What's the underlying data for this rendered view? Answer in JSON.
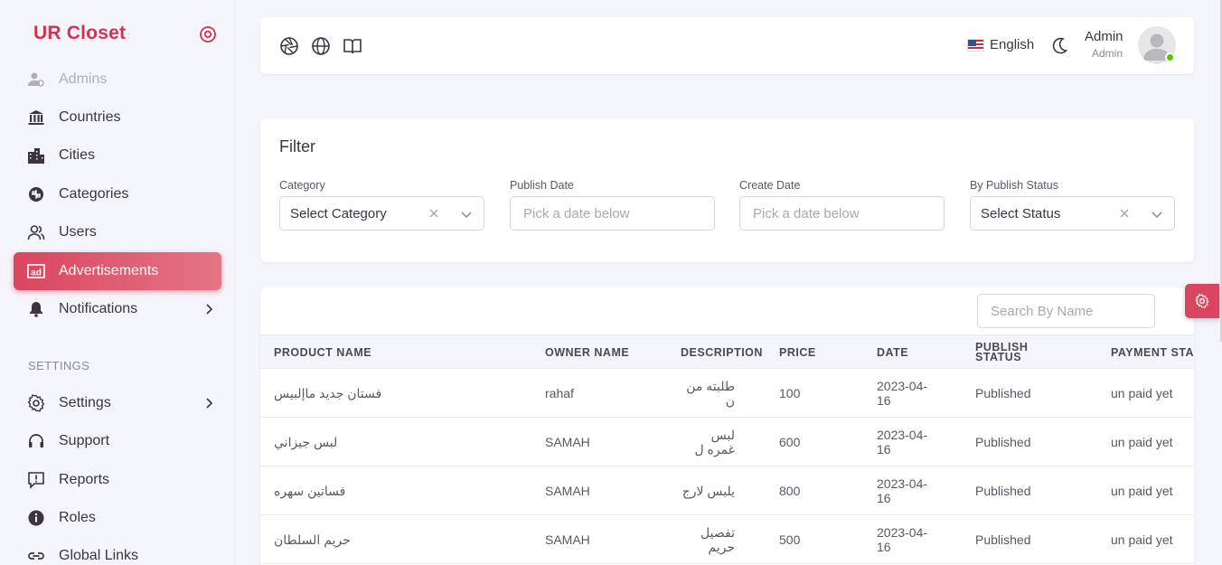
{
  "brand": {
    "name": "UR Closet",
    "color": "#d4324f"
  },
  "sidebar": {
    "items": [
      {
        "label": "Admins",
        "icon": "admin-icon"
      },
      {
        "label": "Countries",
        "icon": "bank-icon"
      },
      {
        "label": "Cities",
        "icon": "city-icon"
      },
      {
        "label": "Categories",
        "icon": "categories-icon"
      },
      {
        "label": "Users",
        "icon": "users-icon"
      },
      {
        "label": "Advertisements",
        "icon": "ad-icon",
        "active": true
      },
      {
        "label": "Notifications",
        "icon": "bell-icon"
      }
    ],
    "section_settings": "SETTINGS",
    "settings_items": [
      {
        "label": "Settings",
        "icon": "gear-icon"
      },
      {
        "label": "Support",
        "icon": "headset-icon"
      },
      {
        "label": "Reports",
        "icon": "report-icon"
      },
      {
        "label": "Roles",
        "icon": "info-icon"
      },
      {
        "label": "Global Links",
        "icon": "link-icon"
      }
    ]
  },
  "topbar": {
    "icons": [
      "aperture-icon",
      "globe-icon",
      "book-icon"
    ],
    "language": "English",
    "user_name": "Admin",
    "user_role": "Admin"
  },
  "filter": {
    "title": "Filter",
    "category_label": "Category",
    "category_value": "Select Category",
    "publish_date_label": "Publish Date",
    "publish_date_placeholder": "Pick a date below",
    "create_date_label": "Create Date",
    "create_date_placeholder": "Pick a date below",
    "status_label": "By Publish Status",
    "status_value": "Select Status"
  },
  "table": {
    "search_placeholder": "Search By Name",
    "headers": [
      "PRODUCT NAME",
      "OWNER NAME",
      "DESCRIPTION",
      "PRICE",
      "DATE",
      "PUBLISH STATUS",
      "PAYMENT STA"
    ],
    "rows": [
      {
        "product": "فستان جديد ماإلبيس",
        "owner": "rahaf",
        "description": "طلبته من ن",
        "price": "100",
        "date": "2023-04-16",
        "publish": "Published",
        "payment": "un paid yet"
      },
      {
        "product": "لبس جيزاني",
        "owner": "SAMAH",
        "description": "لبس غمره ل",
        "price": "600",
        "date": "2023-04-16",
        "publish": "Published",
        "payment": "un paid yet"
      },
      {
        "product": "فساتين سهره",
        "owner": "SAMAH",
        "description": "يلبس لارج",
        "price": "800",
        "date": "2023-04-16",
        "publish": "Published",
        "payment": "un paid yet"
      },
      {
        "product": "حريم السلطان",
        "owner": "SAMAH",
        "description": "تفصيل حريم",
        "price": "500",
        "date": "2023-04-16",
        "publish": "Published",
        "payment": "un paid yet"
      }
    ]
  },
  "colors": {
    "accent": "#d9465f",
    "online": "#56ca00"
  }
}
